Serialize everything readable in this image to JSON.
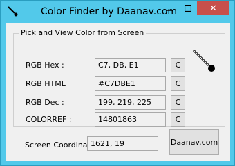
{
  "window": {
    "title": "Color Finder by Daanav.com",
    "close_glyph": "✕"
  },
  "group": {
    "title": "Pick and View Color from Screen"
  },
  "rows": [
    {
      "label": "RGB Hex :",
      "value": "C7, DB, E1",
      "copy_label": "C"
    },
    {
      "label": "RGB HTML",
      "value": "#C7DBE1",
      "copy_label": "C"
    },
    {
      "label": "RGB Dec :",
      "value": "199, 219, 225",
      "copy_label": "C"
    },
    {
      "label": "COLORREF :",
      "value": "14801863",
      "copy_label": "C"
    }
  ],
  "coordinates": {
    "label": "Screen Coordinates",
    "value": "1621, 19"
  },
  "site_button": {
    "label": "Daanav.com"
  },
  "icons": {
    "app": "eyedropper-icon",
    "picker": "eyedropper-icon",
    "minimize": "minimize-icon",
    "maximize": "maximize-icon",
    "close": "close-icon"
  },
  "colors": {
    "titlebar": "#52c9ea",
    "close_button": "#c7504b",
    "client_background": "#f0f0f0",
    "desktop": "#c2185b"
  }
}
